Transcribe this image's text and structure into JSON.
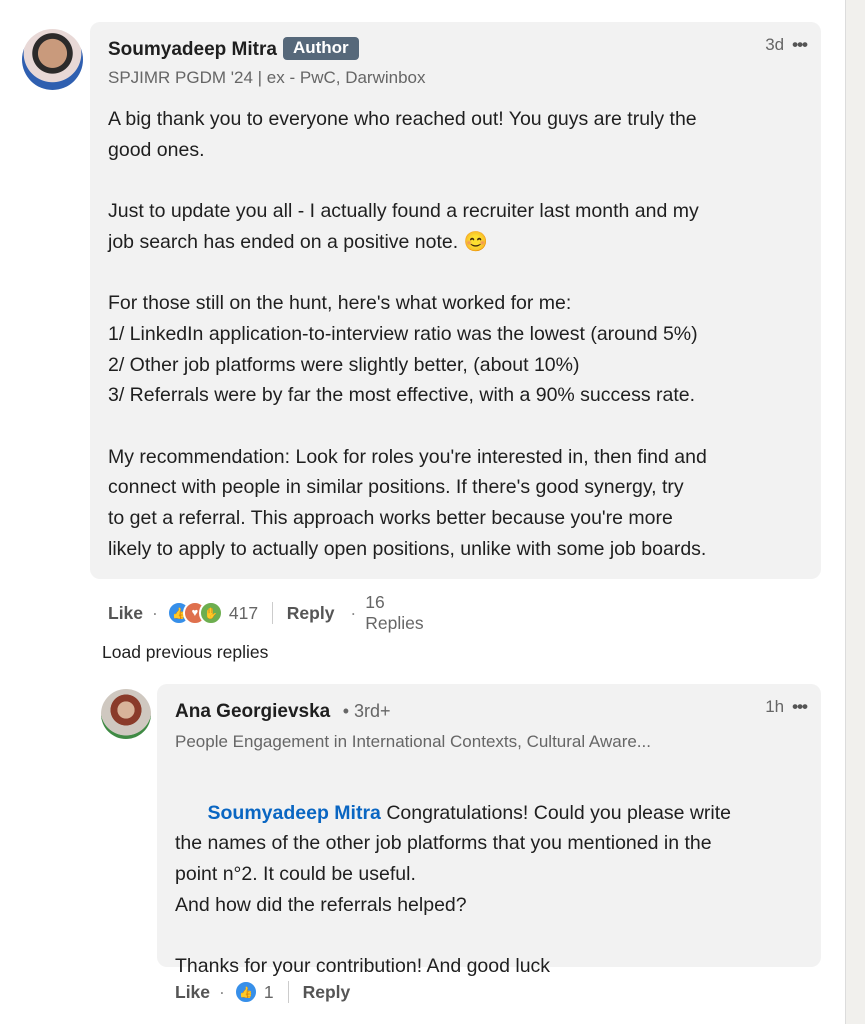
{
  "main_comment": {
    "author": "Soumyadeep Mitra",
    "badge": "Author",
    "headline": "SPJIMR PGDM '24 | ex - PwC, Darwinbox",
    "time": "3d",
    "more_icon": "more-horizontal-icon",
    "body": [
      "A big thank you to everyone who reached out! You guys are truly the",
      "good ones.",
      "",
      "Just to update you all - I actually found a recruiter last month and my",
      "job search has ended on a positive note. 😊",
      "",
      "For those still on the hunt, here's what worked for me:",
      "1/ LinkedIn application-to-interview ratio was the lowest (around 5%)",
      "2/ Other job platforms were slightly better, (about 10%)",
      "3/ Referrals were by far the most effective, with a 90% success rate.",
      "",
      "My recommendation: Look for roles you're interested in, then find and",
      "connect with people in similar positions. If there's good synergy, try",
      "to get a referral. This approach works better because you're more",
      "likely to apply to actually open positions, unlike with some job boards."
    ],
    "actions": {
      "like": "Like",
      "reaction_icons": [
        "like-icon",
        "love-icon",
        "celebrate-icon"
      ],
      "reaction_count": "417",
      "reply": "Reply",
      "replies": "16 Replies"
    }
  },
  "load_previous": "Load previous replies",
  "reply_comment": {
    "author": "Ana Georgievska",
    "degree": "• 3rd+",
    "headline": "People Engagement in International Contexts, Cultural Aware...",
    "time": "1h",
    "mention": "Soumyadeep Mitra",
    "body_first": " Congratulations! Could you please write",
    "body": [
      "the names of the other job platforms that you mentioned in the",
      "point n°2. It could be useful.",
      "And how did the referrals helped?",
      "",
      "Thanks for your contribution! And good luck"
    ],
    "actions": {
      "like": "Like",
      "reaction_icons": [
        "like-icon"
      ],
      "reaction_count": "1",
      "reply": "Reply"
    }
  },
  "colors": {
    "badge": "#56687a",
    "mention": "#0a66c2",
    "like": "#378fe9",
    "love": "#df704d",
    "celebrate": "#6dae4f"
  }
}
